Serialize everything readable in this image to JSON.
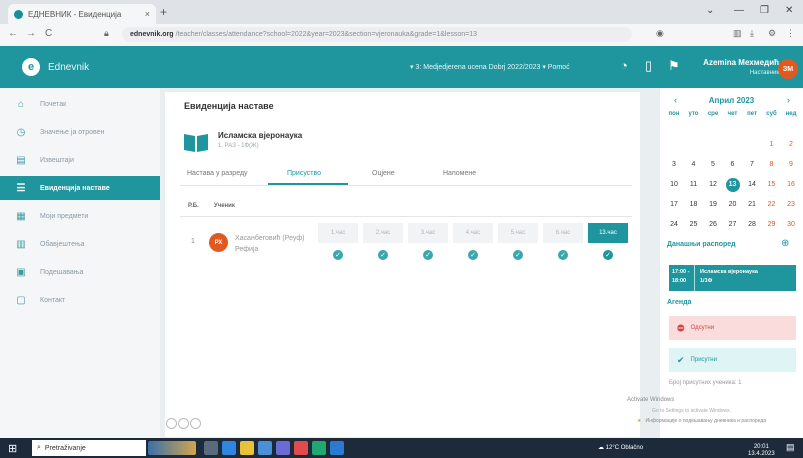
{
  "browser": {
    "tab_title": "EДНЕВНИК - Евиденција",
    "tab_close": "×",
    "new_tab": "+",
    "window_controls": [
      "⌄",
      "—",
      "❐",
      "✕"
    ],
    "nav": [
      "←",
      "→",
      "C"
    ],
    "url_host": "ednevnik.org",
    "url_rest": "/teacher/classes/attendance?school=2022&year=2023&section=vjeronauka&grade=1&lesson=13"
  },
  "header": {
    "app_name": "Ednevnik",
    "logo_letter": "e",
    "school_label": "▾ 3: Medjedjerena ucena Dobrj 2022/2023 ▾ Pomoć",
    "user_name": "Azemina Мехмедић",
    "user_role": "Наставник",
    "avatar_initials": "ЗМ"
  },
  "sidebar": {
    "items": [
      {
        "label": "Почетак",
        "icon": "⌂"
      },
      {
        "label": "Значење ја отровен",
        "icon": "◷"
      },
      {
        "label": "Извештаји",
        "icon": "▤"
      },
      {
        "label": "Евиденција наставе",
        "icon": "☰"
      },
      {
        "label": "Моји предмети",
        "icon": "▦"
      },
      {
        "label": "Обавјештења",
        "icon": "▥"
      },
      {
        "label": "Подешавања",
        "icon": "▣"
      },
      {
        "label": "Контакт",
        "icon": "▢"
      }
    ],
    "active_index": 3
  },
  "main": {
    "title": "Евиденција наставе",
    "subject_name": "Исламска вјеронаука",
    "subject_sub": "1. РАЗ - 1Ф(Ж)",
    "tabs": [
      "Настава у разреду",
      "Присуство",
      "Оцјене",
      "Напомене"
    ],
    "active_tab": 1,
    "col_num": "Р.Б.",
    "col_student": "Ученик",
    "row_num": "1",
    "student_initials": "РХ",
    "student_name": "Хасанбеговић (Реуф) Рефија",
    "hours": [
      "1.час",
      "2.час",
      "3.час",
      "4.час",
      "5.час",
      "6.час",
      "13.час"
    ],
    "active_hour_index": 6,
    "dot_mark": "✓"
  },
  "calendar": {
    "month": "Април 2023",
    "prev": "‹",
    "next": "›",
    "weekdays": [
      "пон",
      "уто",
      "сре",
      "чет",
      "пет",
      "суб",
      "нед"
    ],
    "weeks": [
      [
        "",
        "",
        "",
        "",
        "",
        "1",
        "2"
      ],
      [
        "3",
        "4",
        "5",
        "6",
        "7",
        "8",
        "9"
      ],
      [
        "10",
        "11",
        "12",
        "13",
        "14",
        "15",
        "16"
      ],
      [
        "17",
        "18",
        "19",
        "20",
        "21",
        "22",
        "23"
      ],
      [
        "24",
        "25",
        "26",
        "27",
        "28",
        "29",
        "30"
      ]
    ],
    "today": "13"
  },
  "schedule": {
    "heading": "Данашњи распоред",
    "add": "⊕",
    "time": "17:00 - 18:00",
    "lesson": "Исламска вјеронаука",
    "lesson_sub": "1/1Ф",
    "agenda_heading": "Агенда",
    "absent_label": "Одсутни",
    "present_label": "Присутни",
    "stat_text": "Број присутних ученика: 1",
    "activate_title": "Activate Windows",
    "activate_sub": "Go to Settings to activate Windows.",
    "notif_text": "Информације о подешавању дневника и распореда"
  },
  "taskbar": {
    "search_text": "Pretraživanje",
    "weather": "☁ 12°C Oblačno",
    "time": "20:01",
    "date": "13.4.2023"
  },
  "colors": {
    "teal": "#1f969e",
    "orange": "#e0591f"
  }
}
